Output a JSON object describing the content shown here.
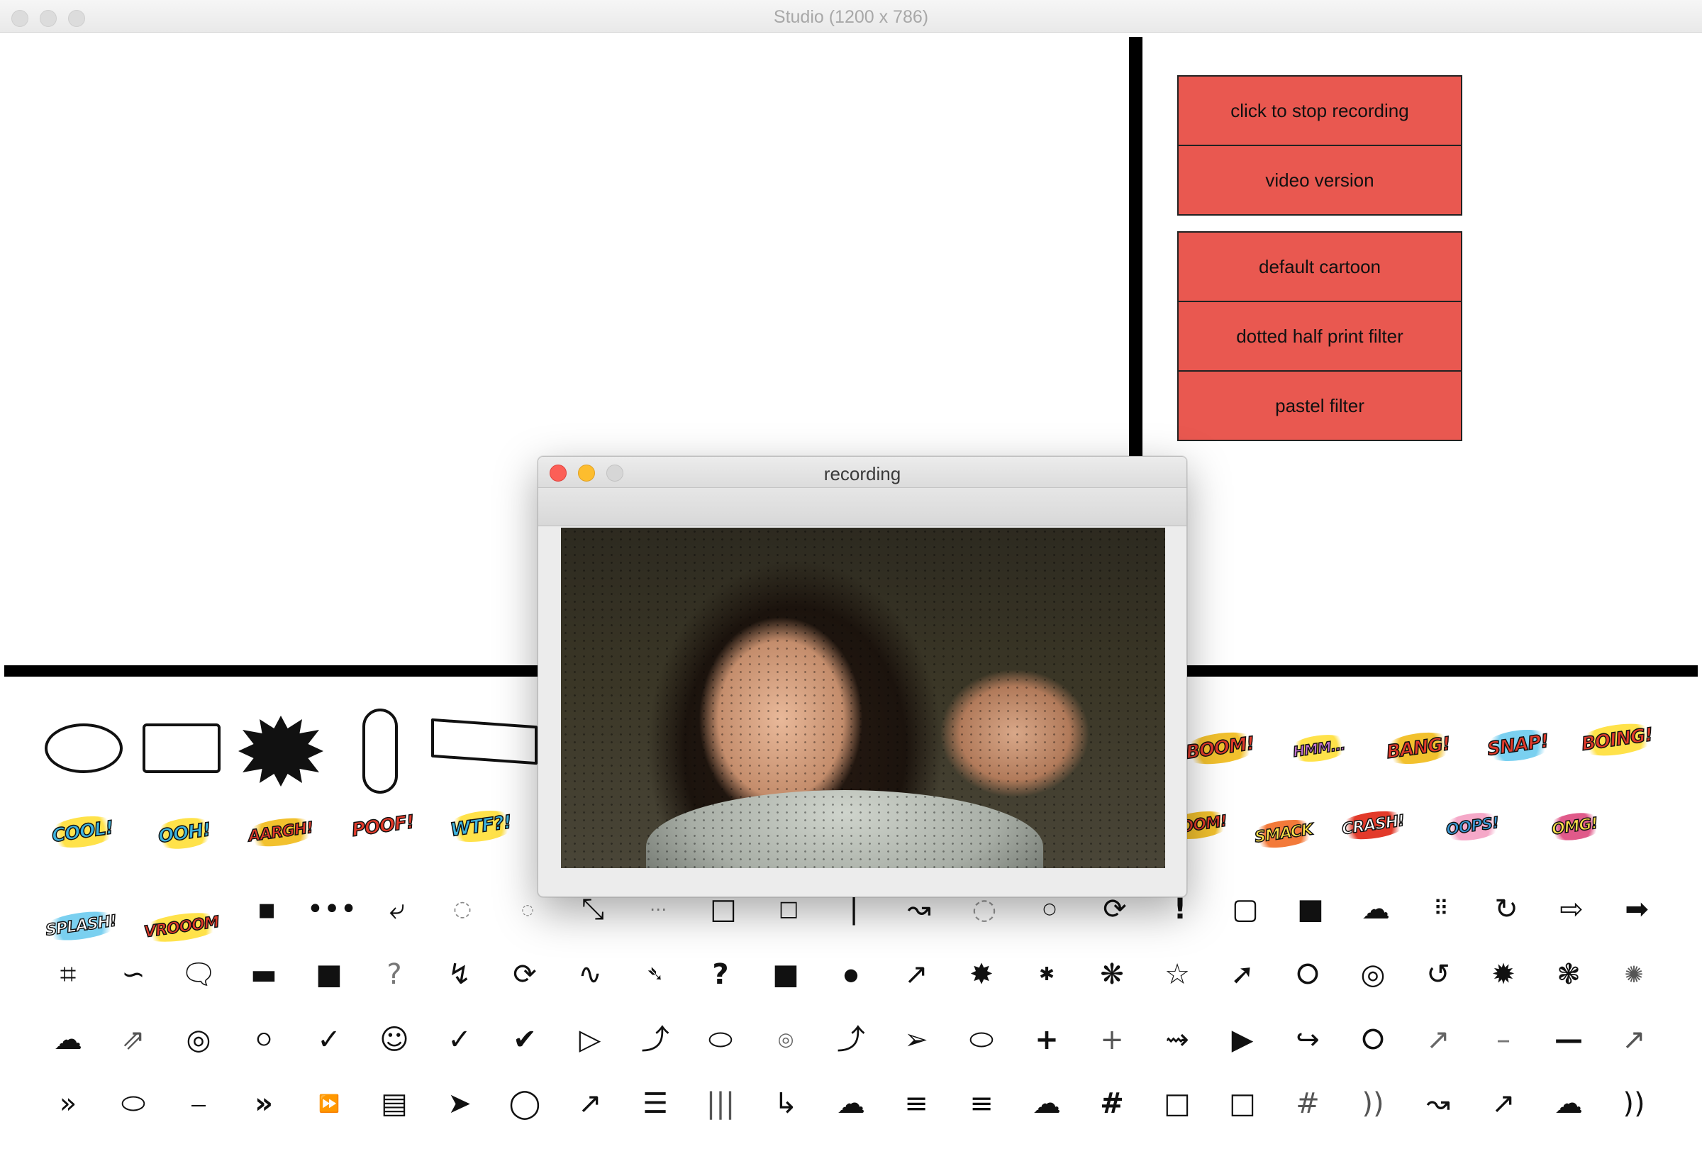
{
  "main_window": {
    "title": "Studio (1200 x 786)"
  },
  "controls": {
    "group1": [
      "click to stop recording",
      "video version"
    ],
    "group2": [
      "default cartoon",
      "dotted half print filter",
      "pastel filter"
    ]
  },
  "recording_window": {
    "title": "recording"
  },
  "stickers": {
    "word_row1": [
      "BOOM!",
      "HMM...",
      "BANG!",
      "SNAP!",
      "BOING!"
    ],
    "word_row2_left": [
      "COOL!",
      "OOH!",
      "AARGH!",
      "POOF!",
      "WTF?!"
    ],
    "word_row2_right": [
      "BOOM!",
      "SMACK",
      "CRASH!",
      "OOPS!",
      "OMG!"
    ],
    "word_row3": [
      "SPLASH!",
      "VROOOM"
    ]
  },
  "colors": {
    "button_fill": "#e95850",
    "divider": "#000000"
  }
}
